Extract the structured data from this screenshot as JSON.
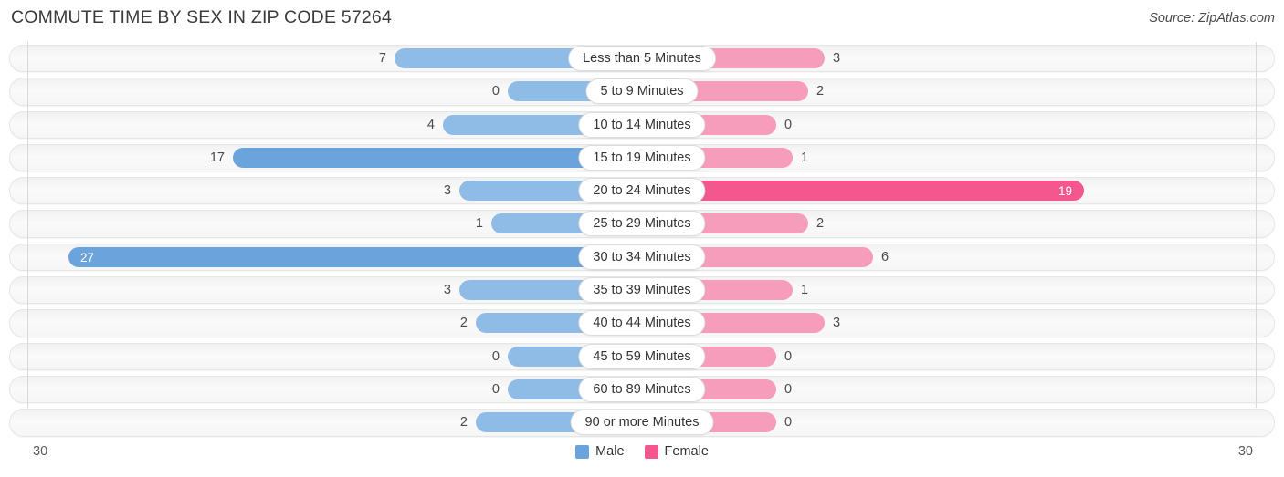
{
  "header": {
    "title": "COMMUTE TIME BY SEX IN ZIP CODE 57264",
    "source": "Source: ZipAtlas.com"
  },
  "legend": {
    "male_label": "Male",
    "female_label": "Female",
    "male_color": "#6BA3DC",
    "female_color": "#F4578E"
  },
  "axis": {
    "left_end_label": "30",
    "right_end_label": "30",
    "max": 30
  },
  "chart_data": {
    "type": "bar",
    "orientation": "horizontal",
    "layout": "diverging-bidirectional",
    "title": "COMMUTE TIME BY SEX IN ZIP CODE 57264",
    "xlabel": "",
    "ylabel": "",
    "xlim": [
      30,
      0,
      30
    ],
    "grid": false,
    "legend_position": "bottom-center",
    "categories": [
      "Less than 5 Minutes",
      "5 to 9 Minutes",
      "10 to 14 Minutes",
      "15 to 19 Minutes",
      "20 to 24 Minutes",
      "25 to 29 Minutes",
      "30 to 34 Minutes",
      "35 to 39 Minutes",
      "40 to 44 Minutes",
      "45 to 59 Minutes",
      "60 to 89 Minutes",
      "90 or more Minutes"
    ],
    "series": [
      {
        "name": "Male",
        "values": [
          7,
          0,
          4,
          17,
          3,
          1,
          27,
          3,
          2,
          0,
          0,
          2
        ]
      },
      {
        "name": "Female",
        "values": [
          3,
          2,
          0,
          1,
          19,
          2,
          6,
          1,
          3,
          0,
          0,
          0
        ]
      }
    ]
  },
  "rows": [
    {
      "label": "Less than 5 Minutes",
      "male": "7",
      "female": "3",
      "male_w": 271,
      "female_w": 200,
      "male_inside": false,
      "female_inside": false,
      "male_shade": "shade-light",
      "female_shade": "shade-light"
    },
    {
      "label": "5 to 9 Minutes",
      "male": "0",
      "female": "2",
      "male_w": 147,
      "female_w": 182,
      "male_inside": false,
      "female_inside": false,
      "male_shade": "shade-light",
      "female_shade": "shade-light"
    },
    {
      "label": "10 to 14 Minutes",
      "male": "4",
      "female": "0",
      "male_w": 218,
      "female_w": 147,
      "male_inside": false,
      "female_inside": false,
      "male_shade": "shade-light",
      "female_shade": "shade-light"
    },
    {
      "label": "15 to 19 Minutes",
      "male": "17",
      "female": "1",
      "male_w": 448,
      "female_w": 165,
      "male_inside": false,
      "female_inside": false,
      "male_shade": "shade-dark",
      "female_shade": "shade-light"
    },
    {
      "label": "20 to 24 Minutes",
      "male": "3",
      "female": "19",
      "male_w": 200,
      "female_w": 484,
      "male_inside": false,
      "female_inside": true,
      "male_shade": "shade-light",
      "female_shade": "shade-dark"
    },
    {
      "label": "25 to 29 Minutes",
      "male": "1",
      "female": "2",
      "male_w": 165,
      "female_w": 182,
      "male_inside": false,
      "female_inside": false,
      "male_shade": "shade-light",
      "female_shade": "shade-light"
    },
    {
      "label": "30 to 34 Minutes",
      "male": "27",
      "female": "6",
      "male_w": 628,
      "female_w": 253,
      "male_inside": true,
      "female_inside": false,
      "male_shade": "shade-dark",
      "female_shade": "shade-light"
    },
    {
      "label": "35 to 39 Minutes",
      "male": "3",
      "female": "1",
      "male_w": 200,
      "female_w": 165,
      "male_inside": false,
      "female_inside": false,
      "male_shade": "shade-light",
      "female_shade": "shade-light"
    },
    {
      "label": "40 to 44 Minutes",
      "male": "2",
      "female": "3",
      "male_w": 182,
      "female_w": 200,
      "male_inside": false,
      "female_inside": false,
      "male_shade": "shade-light",
      "female_shade": "shade-light"
    },
    {
      "label": "45 to 59 Minutes",
      "male": "0",
      "female": "0",
      "male_w": 147,
      "female_w": 147,
      "male_inside": false,
      "female_inside": false,
      "male_shade": "shade-light",
      "female_shade": "shade-light"
    },
    {
      "label": "60 to 89 Minutes",
      "male": "0",
      "female": "0",
      "male_w": 147,
      "female_w": 147,
      "male_inside": false,
      "female_inside": false,
      "male_shade": "shade-light",
      "female_shade": "shade-light"
    },
    {
      "label": "90 or more Minutes",
      "male": "2",
      "female": "0",
      "male_w": 182,
      "female_w": 147,
      "male_inside": false,
      "female_inside": false,
      "male_shade": "shade-light",
      "female_shade": "shade-light"
    }
  ]
}
